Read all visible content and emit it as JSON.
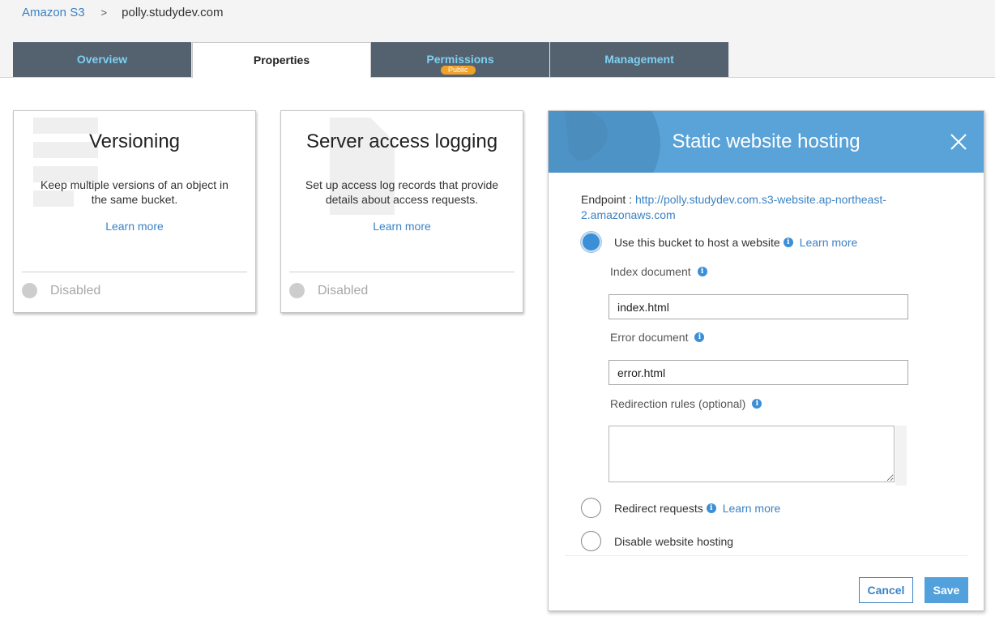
{
  "breadcrumb": {
    "root": "Amazon S3",
    "separator": ">",
    "current": "polly.studydev.com"
  },
  "tabs": [
    {
      "label": "Overview",
      "active": false
    },
    {
      "label": "Properties",
      "active": true
    },
    {
      "label": "Permissions",
      "badge": "Public",
      "active": false
    },
    {
      "label": "Management",
      "active": false
    }
  ],
  "cards": {
    "versioning": {
      "title": "Versioning",
      "description": "Keep multiple versions of an object in the same bucket.",
      "learn_more": "Learn more",
      "status": "Disabled"
    },
    "logging": {
      "title": "Server access logging",
      "description": "Set up access log records that provide details about access requests.",
      "learn_more": "Learn more",
      "status": "Disabled"
    }
  },
  "panel": {
    "title": "Static website hosting",
    "endpoint_label": "Endpoint : ",
    "endpoint_url": "http://polly.studydev.com.s3-website.ap-northeast-2.amazonaws.com",
    "option_host": {
      "label": "Use this bucket to host a website",
      "learn_more": "Learn more",
      "selected": true
    },
    "index_label": "Index document",
    "index_value": "index.html",
    "error_label": "Error document",
    "error_value": "error.html",
    "redirection_label": "Redirection rules (optional)",
    "redirection_value": "",
    "option_redirect": {
      "label": "Redirect requests",
      "learn_more": "Learn more",
      "selected": false
    },
    "option_disable": {
      "label": "Disable website hosting",
      "selected": false
    },
    "cancel_label": "Cancel",
    "save_label": "Save",
    "info_glyph": "i"
  },
  "colors": {
    "accent": "#3b82c4",
    "tab_bg": "#546270",
    "tab_text": "#7fd0f0",
    "panel_header": "#5aa3d8",
    "badge": "#f0a12a",
    "save_button": "#52a1dc"
  },
  "icons": {
    "close": "close-icon",
    "info": "info-icon",
    "status": "status-dot-icon"
  }
}
